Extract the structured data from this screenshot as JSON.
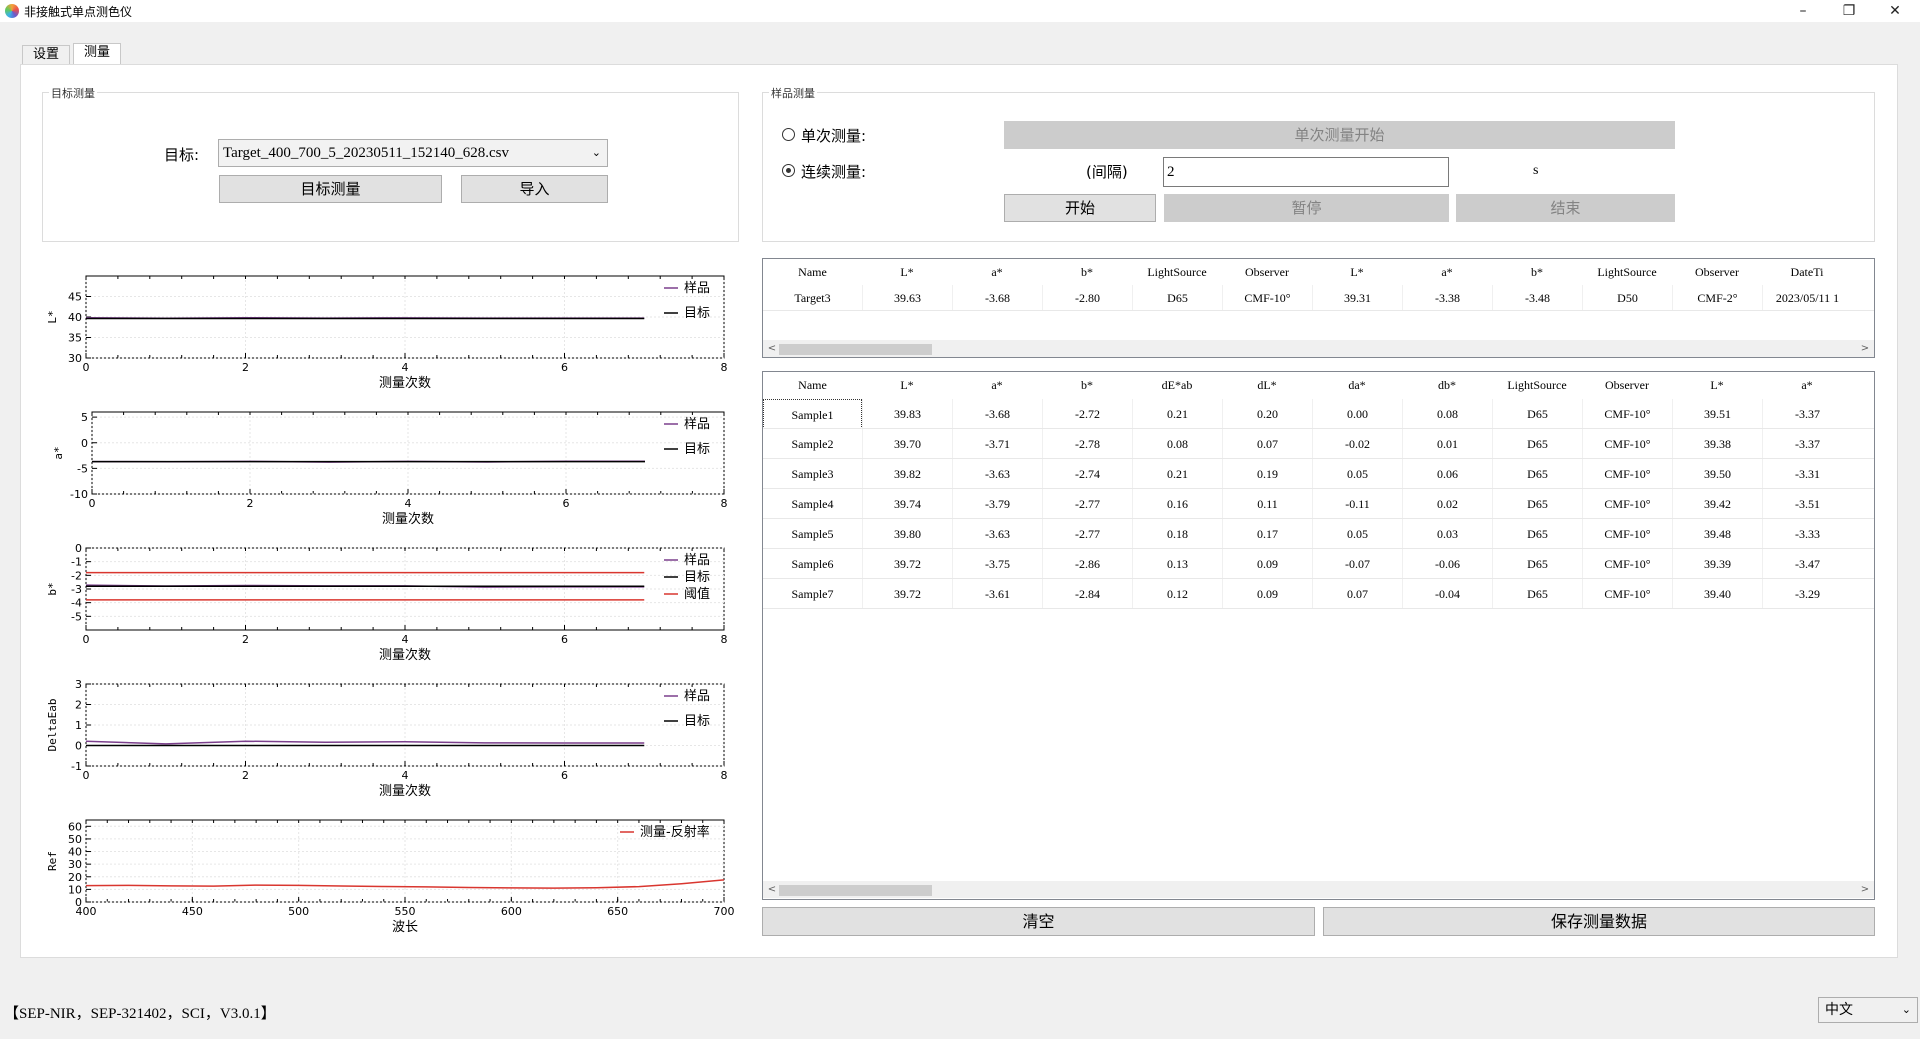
{
  "window": {
    "title": "非接触式单点测色仪",
    "controls": [
      "–",
      "❐",
      "✕"
    ]
  },
  "tabs": [
    {
      "label": "设置"
    },
    {
      "label": "测量",
      "active": true
    }
  ],
  "target_group": {
    "title": "目标测量",
    "target_label": "目标:",
    "target_value": "Target_400_700_5_20230511_152140_628.csv",
    "measure_button": "目标测量",
    "import_button": "导入"
  },
  "sample_group": {
    "title": "样品测量",
    "single_label": "单次测量:",
    "single_start_button": "单次测量开始",
    "continuous_label": "连续测量:",
    "interval_label": "(间隔)",
    "interval_value": "2",
    "interval_unit": "s",
    "start_button": "开始",
    "pause_button": "暂停",
    "end_button": "结束"
  },
  "target_table": {
    "headers": [
      "Name",
      "L*",
      "a*",
      "b*",
      "LightSource",
      "Observer",
      "L*",
      "a*",
      "b*",
      "LightSource",
      "Observer",
      "DateTi"
    ],
    "rows": [
      [
        "Target3",
        "39.63",
        "-3.68",
        "-2.80",
        "D65",
        "CMF-10°",
        "39.31",
        "-3.38",
        "-3.48",
        "D50",
        "CMF-2°",
        "2023/05/11 1"
      ]
    ]
  },
  "sample_table": {
    "headers": [
      "Name",
      "L*",
      "a*",
      "b*",
      "dE*ab",
      "dL*",
      "da*",
      "db*",
      "LightSource",
      "Observer",
      "L*",
      "a*"
    ],
    "rows": [
      [
        "Sample1",
        "39.83",
        "-3.68",
        "-2.72",
        "0.21",
        "0.20",
        "0.00",
        "0.08",
        "D65",
        "CMF-10°",
        "39.51",
        "-3.37"
      ],
      [
        "Sample2",
        "39.70",
        "-3.71",
        "-2.78",
        "0.08",
        "0.07",
        "-0.02",
        "0.01",
        "D65",
        "CMF-10°",
        "39.38",
        "-3.37"
      ],
      [
        "Sample3",
        "39.82",
        "-3.63",
        "-2.74",
        "0.21",
        "0.19",
        "0.05",
        "0.06",
        "D65",
        "CMF-10°",
        "39.50",
        "-3.31"
      ],
      [
        "Sample4",
        "39.74",
        "-3.79",
        "-2.77",
        "0.16",
        "0.11",
        "-0.11",
        "0.02",
        "D65",
        "CMF-10°",
        "39.42",
        "-3.51"
      ],
      [
        "Sample5",
        "39.80",
        "-3.63",
        "-2.77",
        "0.18",
        "0.17",
        "0.05",
        "0.03",
        "D65",
        "CMF-10°",
        "39.48",
        "-3.33"
      ],
      [
        "Sample6",
        "39.72",
        "-3.75",
        "-2.86",
        "0.13",
        "0.09",
        "-0.07",
        "-0.06",
        "D65",
        "CMF-10°",
        "39.39",
        "-3.47"
      ],
      [
        "Sample7",
        "39.72",
        "-3.61",
        "-2.84",
        "0.12",
        "0.09",
        "0.07",
        "-0.04",
        "D65",
        "CMF-10°",
        "39.40",
        "-3.29"
      ]
    ]
  },
  "buttons": {
    "clear": "清空",
    "save": "保存测量数据"
  },
  "status": {
    "text": "【SEP-NIR，SEP-321402，SCI，V3.0.1】",
    "language": "中文"
  },
  "chart_data": [
    {
      "type": "line",
      "ylabel": "L*",
      "xlabel": "测量次数",
      "xlim": [
        0,
        8
      ],
      "ylim": [
        30,
        50
      ],
      "yticks": [
        30,
        35,
        40,
        45
      ],
      "xticks": [
        0,
        2,
        4,
        6,
        8
      ],
      "series": [
        {
          "name": "样品",
          "color": "#7b3f8c",
          "x": [
            0,
            1,
            2,
            3,
            4,
            5,
            6,
            7
          ],
          "y": [
            39.83,
            39.7,
            39.82,
            39.74,
            39.8,
            39.72,
            39.72,
            39.72
          ]
        },
        {
          "name": "目标",
          "color": "#000000",
          "x": [
            0,
            7
          ],
          "y": [
            39.63,
            39.63
          ]
        }
      ]
    },
    {
      "type": "line",
      "ylabel": "a*",
      "xlabel": "测量次数",
      "xlim": [
        0,
        8
      ],
      "ylim": [
        -10,
        6
      ],
      "yticks": [
        -10,
        -5,
        0,
        5
      ],
      "xticks": [
        0,
        2,
        4,
        6,
        8
      ],
      "series": [
        {
          "name": "样品",
          "color": "#7b3f8c",
          "x": [
            0,
            1,
            2,
            3,
            4,
            5,
            6,
            7
          ],
          "y": [
            -3.68,
            -3.71,
            -3.63,
            -3.79,
            -3.63,
            -3.75,
            -3.61,
            -3.61
          ]
        },
        {
          "name": "目标",
          "color": "#000000",
          "x": [
            0,
            7
          ],
          "y": [
            -3.68,
            -3.68
          ]
        }
      ]
    },
    {
      "type": "line",
      "ylabel": "b*",
      "xlabel": "测量次数",
      "xlim": [
        0,
        8
      ],
      "ylim": [
        -6,
        0
      ],
      "yticks": [
        -5,
        -4,
        -3,
        -2,
        -1,
        0
      ],
      "xticks": [
        0,
        2,
        4,
        6,
        8
      ],
      "series": [
        {
          "name": "样品",
          "color": "#7b3f8c",
          "x": [
            0,
            1,
            2,
            3,
            4,
            5,
            6,
            7
          ],
          "y": [
            -2.72,
            -2.78,
            -2.74,
            -2.77,
            -2.77,
            -2.86,
            -2.84,
            -2.84
          ]
        },
        {
          "name": "目标",
          "color": "#000000",
          "x": [
            0,
            7
          ],
          "y": [
            -2.8,
            -2.8
          ]
        },
        {
          "name": "阈值",
          "color": "#d9362f",
          "x": [
            0,
            7
          ],
          "y": [
            -1.8,
            -1.8
          ]
        },
        {
          "name": "",
          "color": "#d9362f",
          "x": [
            0,
            7
          ],
          "y": [
            -3.8,
            -3.8
          ]
        }
      ]
    },
    {
      "type": "line",
      "ylabel": "DeltaEab",
      "xlabel": "测量次数",
      "xlim": [
        0,
        8
      ],
      "ylim": [
        -1,
        3
      ],
      "yticks": [
        -1,
        0,
        1,
        2,
        3
      ],
      "xticks": [
        0,
        2,
        4,
        6,
        8
      ],
      "series": [
        {
          "name": "样品",
          "color": "#7b3f8c",
          "x": [
            0,
            1,
            2,
            3,
            4,
            5,
            6,
            7
          ],
          "y": [
            0.21,
            0.08,
            0.21,
            0.16,
            0.18,
            0.13,
            0.12,
            0.12
          ]
        },
        {
          "name": "目标",
          "color": "#000000",
          "x": [
            0,
            7
          ],
          "y": [
            0,
            0
          ]
        }
      ]
    },
    {
      "type": "line",
      "ylabel": "Ref",
      "xlabel": "波长",
      "xlim": [
        400,
        700
      ],
      "ylim": [
        0,
        65
      ],
      "yticks": [
        0,
        10,
        20,
        30,
        40,
        50,
        60
      ],
      "xticks": [
        400,
        450,
        500,
        550,
        600,
        650,
        700
      ],
      "series": [
        {
          "name": "测量-反射率",
          "color": "#d9362f",
          "x": [
            400,
            420,
            440,
            460,
            480,
            500,
            520,
            540,
            560,
            580,
            600,
            620,
            640,
            660,
            680,
            700
          ],
          "y": [
            13,
            13.2,
            12.8,
            12.6,
            13.4,
            13.2,
            12.7,
            12.3,
            12.0,
            11.5,
            11.2,
            11.0,
            11.3,
            12.2,
            14.5,
            17.5
          ]
        }
      ]
    }
  ]
}
